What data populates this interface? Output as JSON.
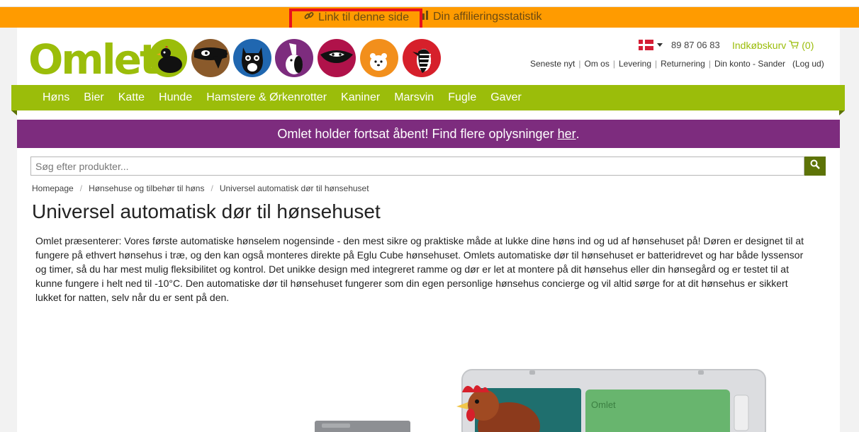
{
  "affiliate": {
    "link_label": "Link til denne side",
    "stats_label": "Din affilieringsstatistik"
  },
  "brand": {
    "logo_text": "Omlet",
    "green": "#9bbd0a",
    "dark_green": "#5d7307",
    "purple": "#7d2c7e",
    "orange": "#ff9b00"
  },
  "animals": [
    {
      "name": "chicken-icon",
      "color": "#9bbd0a"
    },
    {
      "name": "dog-icon",
      "color": "#8a5a2b"
    },
    {
      "name": "cat-icon",
      "color": "#2067b0"
    },
    {
      "name": "rabbit-icon",
      "color": "#7d2c7e"
    },
    {
      "name": "guinea-pig-icon",
      "color": "#b0124a"
    },
    {
      "name": "hamster-icon",
      "color": "#f28f1c"
    },
    {
      "name": "bird-icon",
      "color": "#d6202b"
    }
  ],
  "header": {
    "phone": "89 87 06 83",
    "cart_label": "Indkøbskurv",
    "cart_count": "(0)",
    "links": [
      "Seneste nyt",
      "Om os",
      "Levering",
      "Returnering",
      "Din konto - Sander",
      "(Log ud)"
    ]
  },
  "nav": [
    "Høns",
    "Bier",
    "Katte",
    "Hunde",
    "Hamstere & Ørkenrotter",
    "Kaniner",
    "Marsvin",
    "Fugle",
    "Gaver"
  ],
  "banner": {
    "text": "Omlet holder fortsat åbent! Find flere oplysninger",
    "link": "her",
    "end": "."
  },
  "search": {
    "placeholder": "Søg efter produkter..."
  },
  "breadcrumb": [
    "Homepage",
    "Hønsehuse og tilbehør til høns",
    "Universel automatisk dør til hønsehuset"
  ],
  "product": {
    "title": "Universel automatisk dør til hønsehuset",
    "description": "Omlet præsenterer: Vores første automatiske hønselem nogensinde - den mest sikre og praktiske måde at lukke dine høns ind og ud af hønsehuset på! Døren er designet til at fungere på ethvert hønsehus i træ, og den kan også monteres direkte på Eglu Cube hønsehuset. Omlets automatiske dør til hønsehuset er batteridrevet og har både lyssensor og timer, så du har mest mulig fleksibilitet og kontrol. Det unikke design med integreret ramme og dør er let at montere på dit hønsehus eller din hønsegård og er testet til at kunne fungere i helt ned til -10°C. Den automatiske dør til hønsehuset fungerer som din egen personlige hønsehus concierge og vil altid sørge for at dit hønsehus er sikkert lukket for natten, selv når du er sent på den.",
    "door_label": "Omlet"
  }
}
